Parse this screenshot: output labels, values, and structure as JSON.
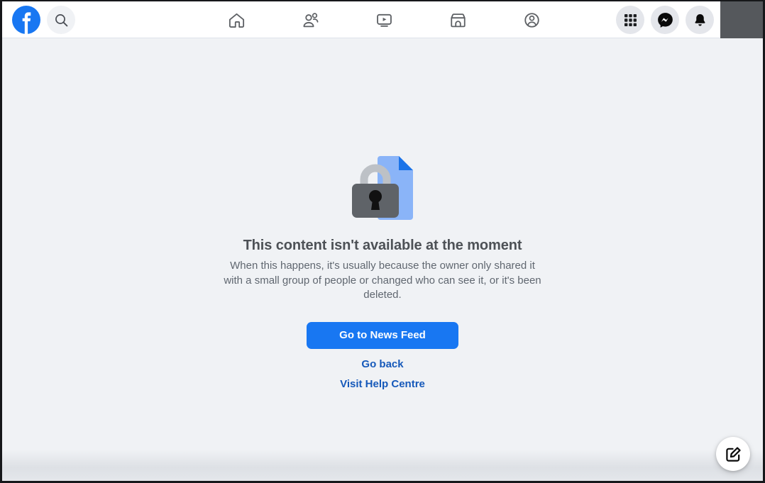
{
  "header": {
    "logo_icon": "facebook-logo-icon",
    "search_icon": "search-icon",
    "nav_tabs": [
      {
        "id": "home",
        "label": "Home",
        "icon": "home-icon"
      },
      {
        "id": "friends",
        "label": "Friends",
        "icon": "friends-icon"
      },
      {
        "id": "video",
        "label": "Video",
        "icon": "video-play-icon"
      },
      {
        "id": "marketplace",
        "label": "Marketplace",
        "icon": "marketplace-storefront-icon"
      },
      {
        "id": "groups",
        "label": "Groups",
        "icon": "groups-icon"
      }
    ],
    "actions": [
      {
        "id": "menu",
        "label": "Menu",
        "icon": "grid-menu-icon"
      },
      {
        "id": "messenger",
        "label": "Messenger",
        "icon": "messenger-icon"
      },
      {
        "id": "notifications",
        "label": "Notifications",
        "icon": "bell-icon"
      }
    ],
    "avatar": {
      "label": "Account",
      "icon": "avatar-redacted"
    }
  },
  "content": {
    "illustration_icon": "locked-document-icon",
    "heading": "This content isn't available at the moment",
    "body": "When this happens, it's usually because the owner only shared it with a small group of people or changed who can see it, or it's been deleted.",
    "primary_button": "Go to News Feed",
    "links": [
      {
        "id": "go-back",
        "label": "Go back"
      },
      {
        "id": "help-centre",
        "label": "Visit Help Centre"
      }
    ]
  },
  "floating": {
    "compose_label": "Create post",
    "compose_icon": "compose-pencil-icon"
  },
  "colors": {
    "brand_blue": "#1877f2",
    "link_blue": "#1659ba",
    "page_bg": "#f0f2f5",
    "header_bg": "#ffffff",
    "heading_text": "#4d5156",
    "body_text": "#606770",
    "doc_blue": "#8ab4f8",
    "doc_fold_blue": "#1a73e8",
    "lock_body": "#5f6368",
    "lock_shackle": "#bdc1c6",
    "avatar_redacted": "#55585c"
  }
}
